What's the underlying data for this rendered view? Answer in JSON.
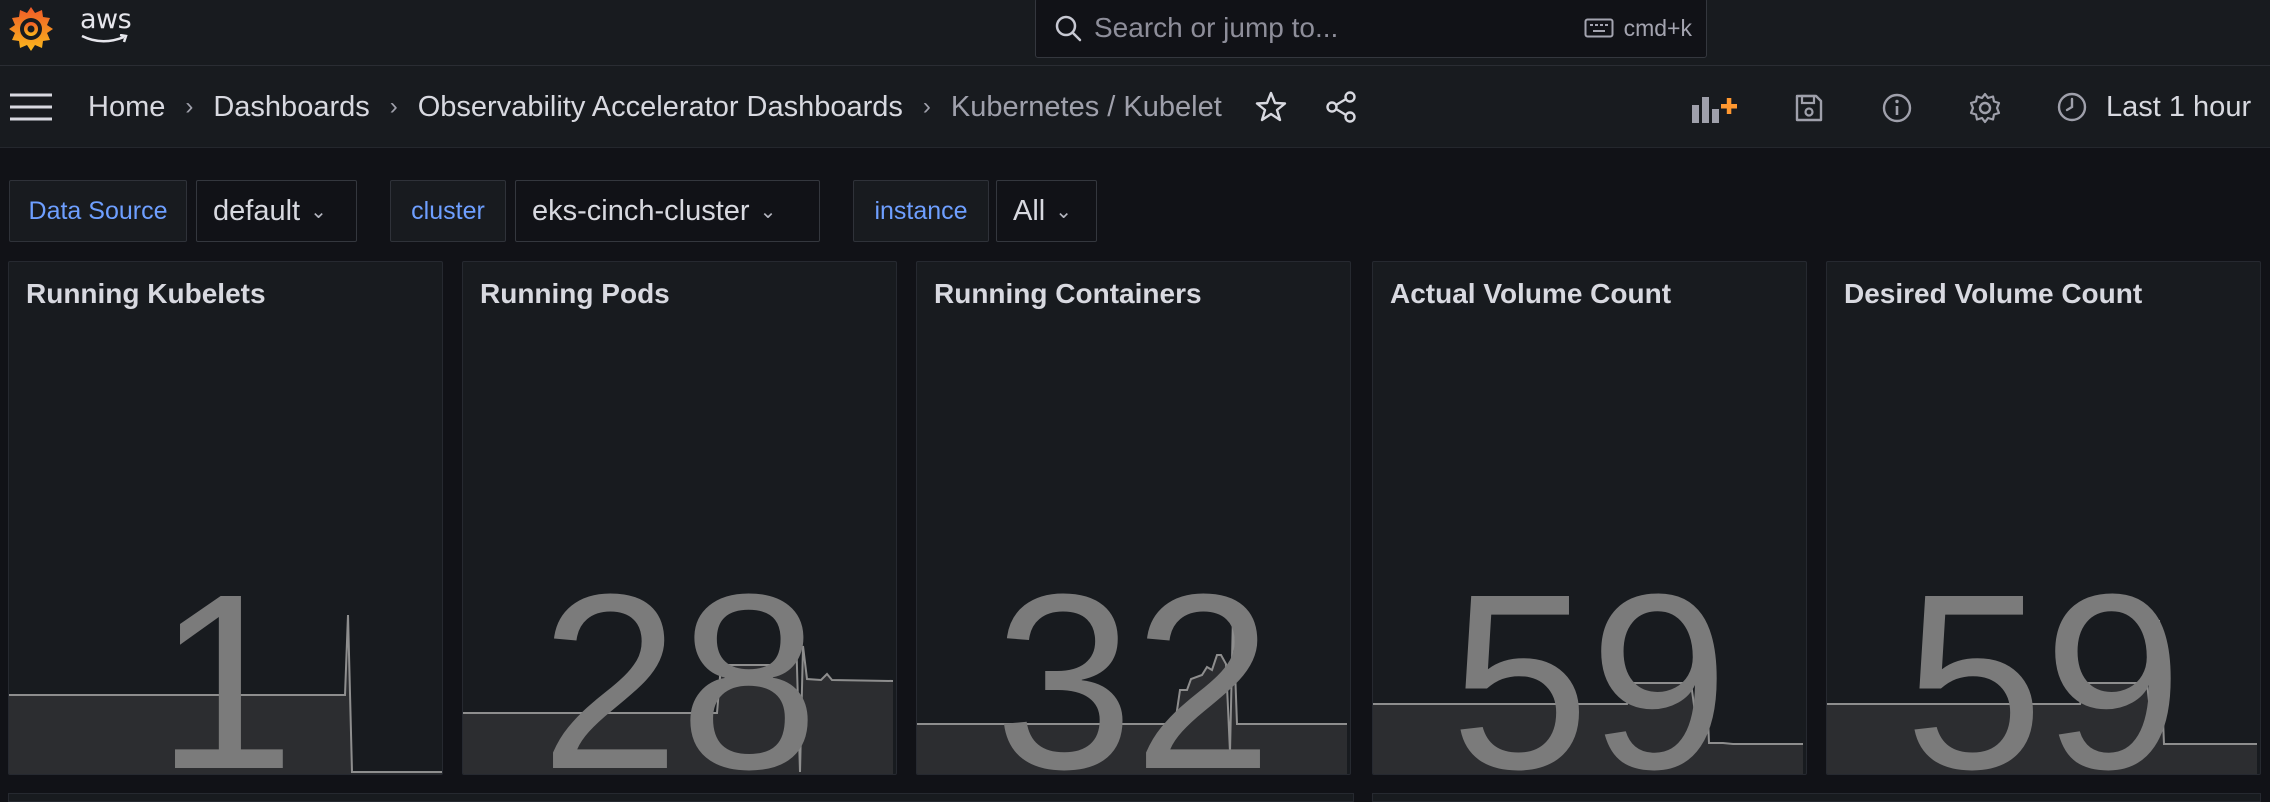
{
  "topbar": {
    "brand_text": "aws",
    "search_placeholder": "Search or jump to...",
    "search_shortcut": "cmd+k"
  },
  "breadcrumb": {
    "items": [
      "Home",
      "Dashboards",
      "Observability Accelerator Dashboards",
      "Kubernetes / Kubelet"
    ]
  },
  "toolbar": {
    "time_range": "Last 1 hour",
    "icons": [
      "add-panel-icon",
      "save-icon",
      "info-icon",
      "settings-icon"
    ]
  },
  "variables": [
    {
      "label": "Data Source",
      "value": "default"
    },
    {
      "label": "cluster",
      "value": "eks-cinch-cluster"
    },
    {
      "label": "instance",
      "value": "All"
    }
  ],
  "panels": [
    {
      "title": "Running Kubelets",
      "value": "1"
    },
    {
      "title": "Running Pods",
      "value": "28"
    },
    {
      "title": "Running Containers",
      "value": "32"
    },
    {
      "title": "Actual Volume Count",
      "value": "59"
    },
    {
      "title": "Desired Volume Count",
      "value": "59"
    }
  ],
  "colors": {
    "background": "#111217",
    "panel": "#181b1f",
    "variable_label": "#6e9fff",
    "stat_value": "#7b7b7b",
    "add_panel_accent": "#ff9830"
  }
}
